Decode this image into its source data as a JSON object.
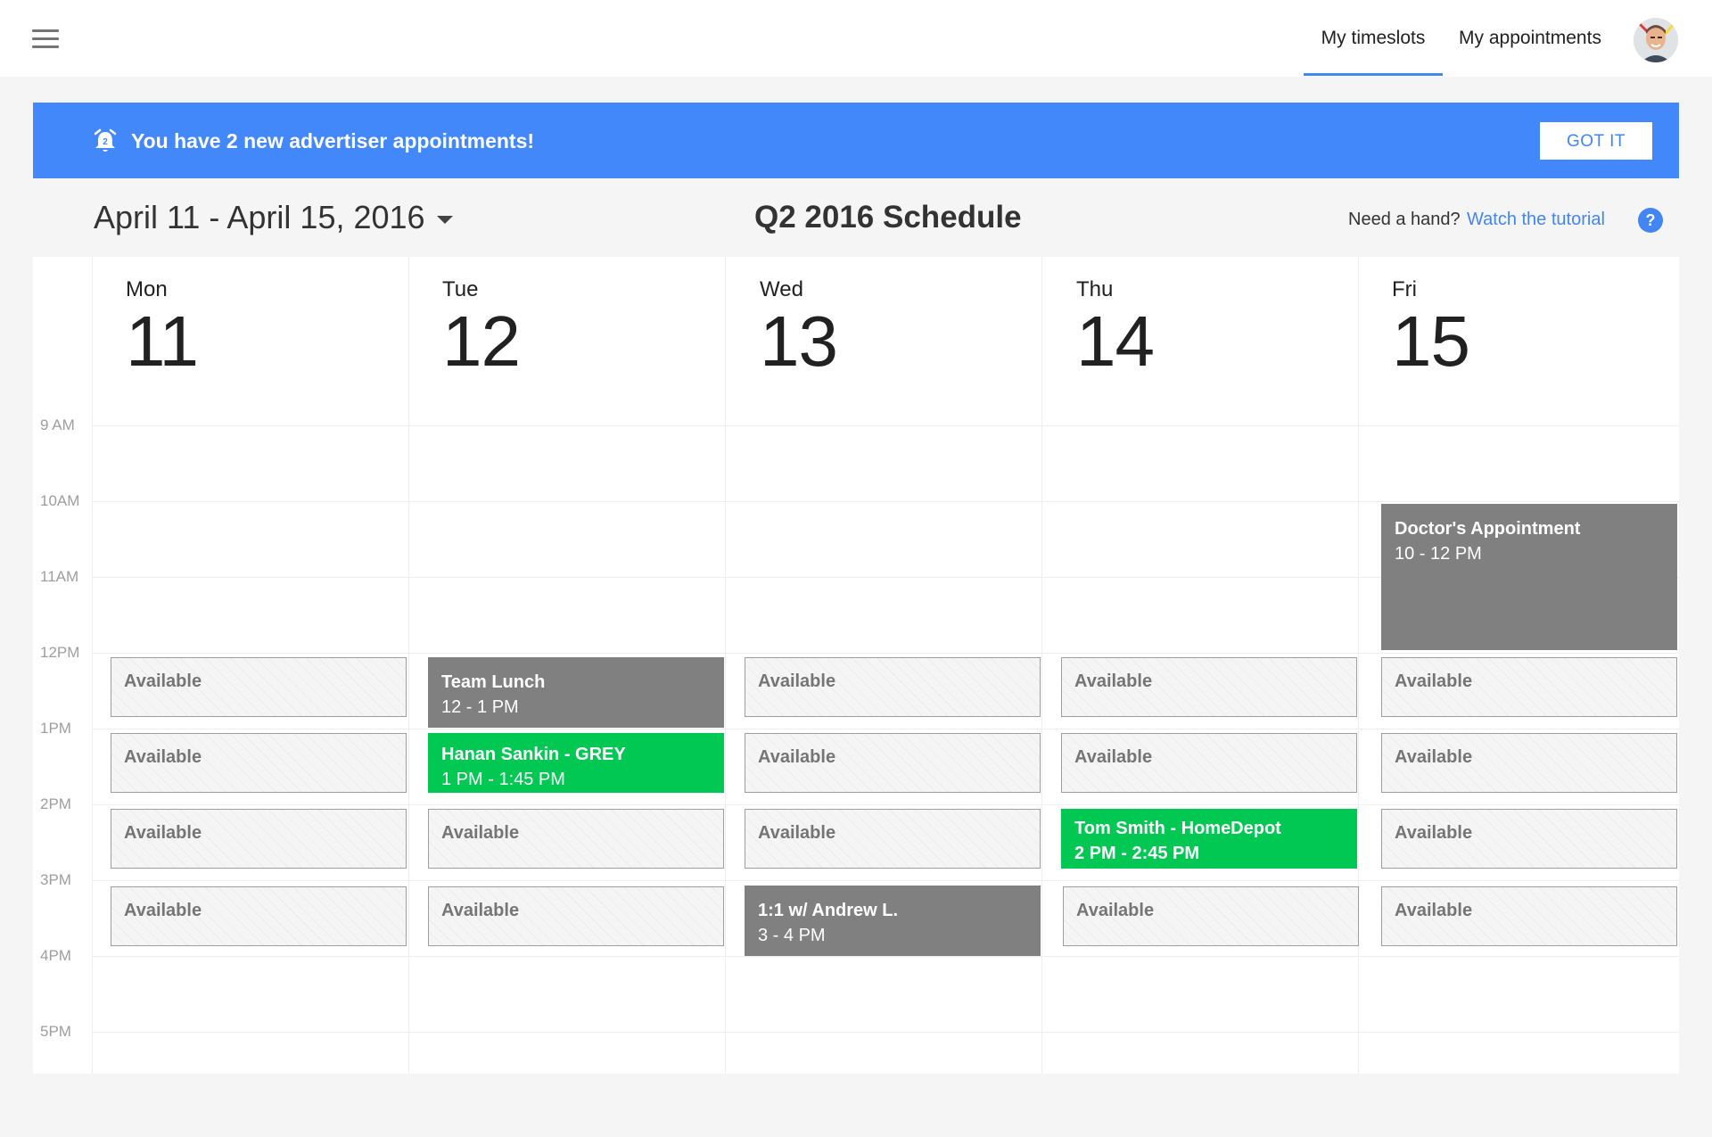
{
  "nav": {
    "tabs": [
      {
        "label": "My timeslots",
        "active": true
      },
      {
        "label": "My appointments",
        "active": false
      }
    ],
    "avatar_icon": "user-avatar"
  },
  "banner": {
    "icon": "alarm-bell-icon",
    "message": "You have 2 new advertiser appointments!",
    "button_label": "GOT IT",
    "color": "#4388fb"
  },
  "header": {
    "date_range": "April 11 - April 15, 2016",
    "title": "Q2 2016 Schedule",
    "help_prefix": "Need a hand?",
    "help_link": "Watch the tutorial"
  },
  "calendar": {
    "time_labels": [
      "9 AM",
      "10AM",
      "11AM",
      "12PM",
      "1PM",
      "2PM",
      "3PM",
      "4PM",
      "5PM"
    ],
    "days": [
      {
        "name": "Mon",
        "number": "11"
      },
      {
        "name": "Tue",
        "number": "12"
      },
      {
        "name": "Wed",
        "number": "13"
      },
      {
        "name": "Thu",
        "number": "14"
      },
      {
        "name": "Fri",
        "number": "15"
      }
    ],
    "available_label": "Available",
    "colors": {
      "event": "#808080",
      "appointment": "#00c853"
    },
    "events": [
      {
        "day": "Fri",
        "title": "Doctor's Appointment",
        "time": "10 - 12 PM",
        "kind": "event"
      },
      {
        "day": "Tue",
        "title": "Team Lunch",
        "time": "12 - 1 PM",
        "kind": "event"
      },
      {
        "day": "Tue",
        "title": "Hanan Sankin - GREY",
        "time": "1 PM - 1:45 PM",
        "kind": "appointment"
      },
      {
        "day": "Thu",
        "title": "Tom Smith - HomeDepot",
        "time": "2 PM - 2:45 PM",
        "kind": "appointment"
      },
      {
        "day": "Wed",
        "title": "1:1 w/ Andrew L.",
        "time": "3 - 4 PM",
        "kind": "event"
      }
    ]
  }
}
